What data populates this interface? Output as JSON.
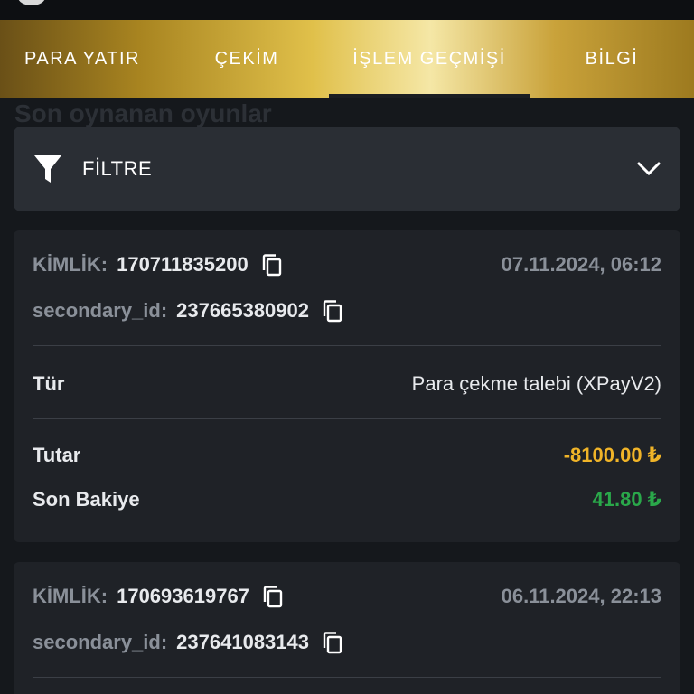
{
  "tabs": [
    {
      "label": "PARA YATIR"
    },
    {
      "label": "ÇEKİM"
    },
    {
      "label": "İŞLEM GEÇMİŞİ",
      "active": true
    },
    {
      "label": "BİLGİ"
    }
  ],
  "background": {
    "title": "Son oynanan oyunlar"
  },
  "filter": {
    "label": "FİLTRE"
  },
  "transactions": [
    {
      "id_label": "KİMLİK:",
      "id_value": "170711835200",
      "date": "07.11.2024, 06:12",
      "secondary_label": "secondary_id:",
      "secondary_value": "237665380902",
      "type_label": "Tür",
      "type_value": "Para çekme talebi (XPayV2)",
      "amount_label": "Tutar",
      "amount_value": "-8100.00 ₺",
      "balance_label": "Son Bakiye",
      "balance_value": "41.80 ₺"
    },
    {
      "id_label": "KİMLİK:",
      "id_value": "170693619767",
      "date": "06.11.2024, 22:13",
      "secondary_label": "secondary_id:",
      "secondary_value": "237641083143"
    }
  ],
  "colors": {
    "negative": "#f0b428",
    "positive": "#2aa84a",
    "card": "#1f2227",
    "gold": "#e0c04a"
  },
  "icons": [
    "funnel-icon",
    "chevron-down-icon",
    "copy-icon"
  ]
}
